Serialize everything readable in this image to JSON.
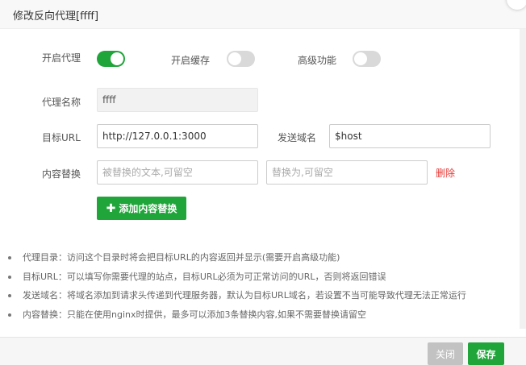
{
  "dialog": {
    "title": "修改反向代理[ffff]"
  },
  "form": {
    "proxy_enable_label": "开启代理",
    "proxy_enable": true,
    "cache_enable_label": "开启缓存",
    "cache_enable": false,
    "advanced_label": "高级功能",
    "advanced": false,
    "name_label": "代理名称",
    "name_value": "ffff",
    "target_url_label": "目标URL",
    "target_url_value": "http://127.0.0.1:3000",
    "send_domain_label": "发送域名",
    "send_domain_value": "$host",
    "replace_label": "内容替换",
    "replace_from_placeholder": "被替换的文本,可留空",
    "replace_to_placeholder": "替换为,可留空",
    "delete_label": "删除",
    "add_replace_label": "添加内容替换"
  },
  "notes": [
    "代理目录：访问这个目录时将会把目标URL的内容返回并显示(需要开启高级功能)",
    "目标URL：可以填写你需要代理的站点，目标URL必须为可正常访问的URL，否则将返回错误",
    "发送域名：将域名添加到请求头传递到代理服务器，默认为目标URL域名，若设置不当可能导致代理无法正常运行",
    "内容替换：只能在使用nginx时提供，最多可以添加3条替换内容,如果不需要替换请留空"
  ],
  "footer": {
    "cancel_label": "关闭",
    "save_label": "保存"
  },
  "colors": {
    "accent": "#20a53a",
    "danger": "#e53935",
    "toggle_off": "#d9d9d9"
  }
}
